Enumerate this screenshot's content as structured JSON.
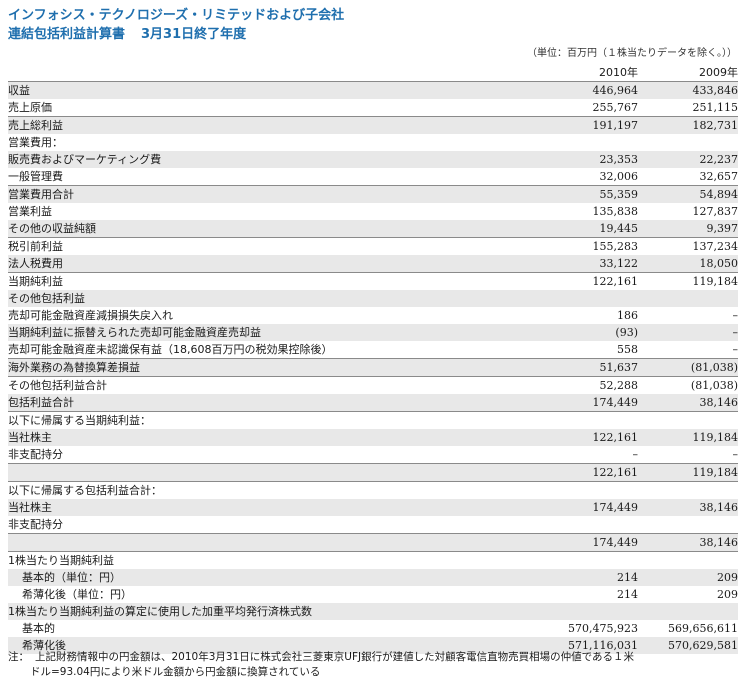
{
  "header": {
    "company": "インフォシス・テクノロジーズ・リミテッドおよび子会社",
    "title": "連結包括利益計算書",
    "period": "3月31日終了年度",
    "unit_note": "（単位：百万円（１株当たりデータを除く。））"
  },
  "columns": [
    "2010年",
    "2009年"
  ],
  "rows": [
    {
      "label": "収益",
      "v1": "446,964",
      "v2": "433,846",
      "style": "shaded"
    },
    {
      "label": "売上原価",
      "v1": "255,767",
      "v2": "251,115",
      "style": "line"
    },
    {
      "label": "売上総利益",
      "v1": "191,197",
      "v2": "182,731",
      "style": "shaded"
    },
    {
      "label": "営業費用：",
      "v1": "",
      "v2": "",
      "style": "plain"
    },
    {
      "label": "販売費およびマーケティング費",
      "v1": "23,353",
      "v2": "22,237",
      "style": "shaded"
    },
    {
      "label": "一般管理費",
      "v1": "32,006",
      "v2": "32,657",
      "style": "line"
    },
    {
      "label": "営業費用合計",
      "v1": "55,359",
      "v2": "54,894",
      "style": "shaded"
    },
    {
      "label": "営業利益",
      "v1": "135,838",
      "v2": "127,837",
      "style": "plain"
    },
    {
      "label": "その他の収益純額",
      "v1": "19,445",
      "v2": "9,397",
      "style": "shaded-line"
    },
    {
      "label": "税引前利益",
      "v1": "155,283",
      "v2": "137,234",
      "style": "plain"
    },
    {
      "label": "法人税費用",
      "v1": "33,122",
      "v2": "18,050",
      "style": "shaded-line"
    },
    {
      "label": "当期純利益",
      "v1": "122,161",
      "v2": "119,184",
      "style": "plain"
    },
    {
      "label": "その他包括利益",
      "v1": "",
      "v2": "",
      "style": "shaded"
    },
    {
      "label": "売却可能金融資産減損損失戻入れ",
      "v1": "186",
      "v2": "–",
      "style": "plain"
    },
    {
      "label": "当期純利益に振替えられた売却可能金融資産売却益",
      "v1": "(93)",
      "v2": "–",
      "style": "shaded"
    },
    {
      "label": "売却可能金融資産未認識保有益（18,608百万円の税効果控除後）",
      "v1": "558",
      "v2": "–",
      "style": "line"
    },
    {
      "label": "海外業務の為替換算差損益",
      "v1": "51,637",
      "v2": "(81,038)",
      "style": "shaded-line"
    },
    {
      "label": "その他包括利益合計",
      "v1": "52,288",
      "v2": "(81,038)",
      "style": "plain"
    },
    {
      "label": "包括利益合計",
      "v1": "174,449",
      "v2": "38,146",
      "style": "shaded-line"
    },
    {
      "label": "以下に帰属する当期純利益：",
      "v1": "",
      "v2": "",
      "style": "plain"
    },
    {
      "label": "当社株主",
      "v1": "122,161",
      "v2": "119,184",
      "style": "shaded"
    },
    {
      "label": "非支配持分",
      "v1": "–",
      "v2": "–",
      "style": "line"
    },
    {
      "label": "",
      "v1": "122,161",
      "v2": "119,184",
      "style": "shaded"
    },
    {
      "label": "以下に帰属する包括利益合計：",
      "v1": "",
      "v2": "",
      "style": "sumline"
    },
    {
      "label": "当社株主",
      "v1": "174,449",
      "v2": "38,146",
      "style": "shaded"
    },
    {
      "label": "非支配持分",
      "v1": "",
      "v2": "",
      "style": "line"
    },
    {
      "label": "",
      "v1": "174,449",
      "v2": "38,146",
      "style": "shaded"
    },
    {
      "label": "1株当たり当期純利益",
      "v1": "",
      "v2": "",
      "style": "sumline"
    },
    {
      "label": "基本的（単位：円）",
      "v1": "214",
      "v2": "209",
      "style": "shaded-indent"
    },
    {
      "label": "希薄化後（単位：円）",
      "v1": "214",
      "v2": "209",
      "style": "indent"
    },
    {
      "label": "1株当たり当期純利益の算定に使用した加重平均発行済株式数",
      "v1": "",
      "v2": "",
      "style": "shaded"
    },
    {
      "label": "基本的",
      "v1": "570,475,923",
      "v2": "569,656,611",
      "style": "indent"
    },
    {
      "label": "希薄化後",
      "v1": "571,116,031",
      "v2": "570,629,581",
      "style": "shaded-indent"
    }
  ],
  "footnote": {
    "label": "注：",
    "line1": "上記財務情報中の円金額は、2010年3月31日に株式会社三菱東京UFJ銀行が建値した対顧客電信直物売買相場の仲値である１米",
    "line2": "ドル=93.04円により米ドル金額から円金額に換算されている"
  }
}
